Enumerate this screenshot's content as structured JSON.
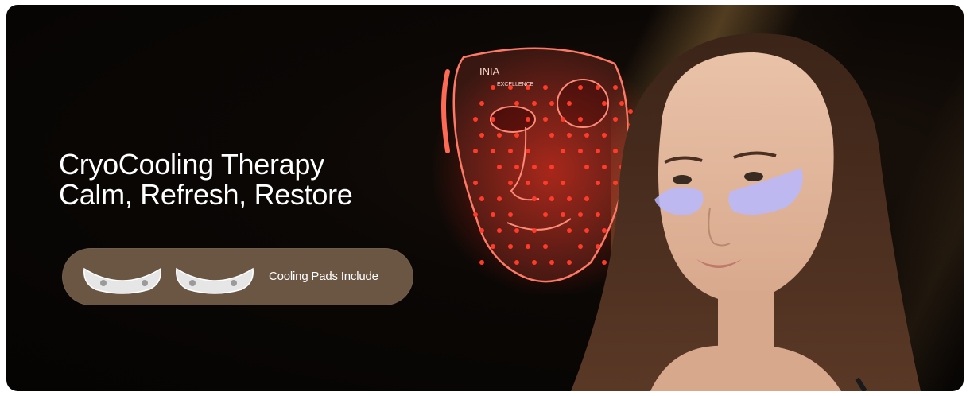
{
  "hero": {
    "headline_line1": "CryoCooling Therapy",
    "headline_line2": "Calm, Refresh, Restore"
  },
  "feature_pill": {
    "label": "Cooling Pads Include"
  },
  "mask": {
    "brand_text": "INIA",
    "tagline": "EXCELLENCE"
  },
  "colors": {
    "background": "#050403",
    "pill": "#6b5644",
    "led_red": "#ff3b2a",
    "eye_pad": "#b8b8ff"
  }
}
